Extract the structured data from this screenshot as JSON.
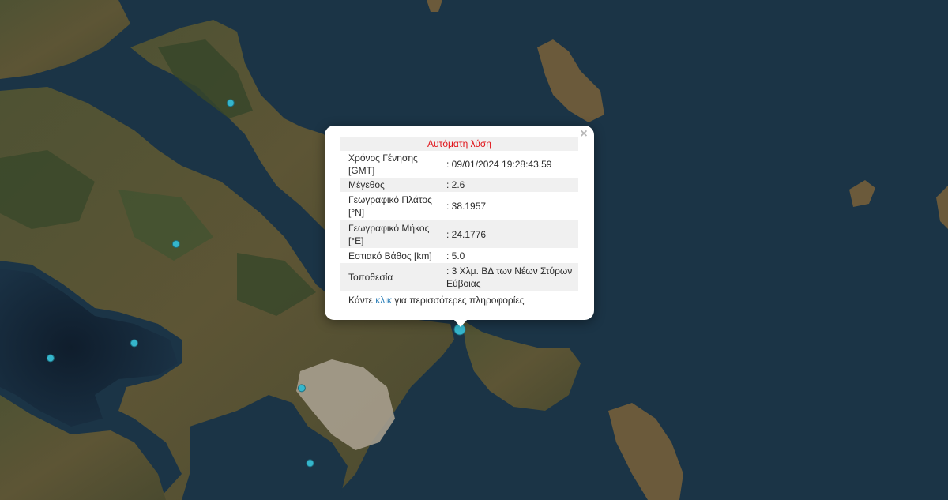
{
  "map": {
    "colors": {
      "sea": "#1b3446",
      "deep_sea": "#132333",
      "land": "#5a5436",
      "forest": "#3b4a2a",
      "urban": "#a89f8e",
      "marker_fill": "#35b6cc",
      "marker_stroke": "#1d6f80",
      "marker_green": "#2e9a63"
    },
    "markers": [
      {
        "name": "quake-marker-selected",
        "lon": 24.1776,
        "lat": 38.1957
      },
      {
        "name": "quake-marker",
        "lon": 23.8,
        "lat": 38.0
      },
      {
        "name": "quake-marker",
        "lon": 23.2,
        "lat": 38.1
      },
      {
        "name": "quake-marker",
        "lon": 22.75,
        "lat": 38.1
      },
      {
        "name": "quake-marker",
        "lon": 23.02,
        "lat": 38.35
      },
      {
        "name": "quake-marker",
        "lon": 23.4,
        "lat": 38.15
      },
      {
        "name": "quake-marker",
        "lon": 23.5,
        "lat": 38.48
      },
      {
        "name": "quake-marker",
        "lon": 23.63,
        "lat": 38.95
      },
      {
        "name": "quake-marker",
        "lon": 23.82,
        "lat": 37.75
      },
      {
        "name": "quake-marker-green",
        "lon": 22.93,
        "lat": 38.7
      }
    ]
  },
  "popup": {
    "heading": "Αυτόματη λύση",
    "rows": [
      {
        "label": "Χρόνος Γένησης [GMT]",
        "value": ": 09/01/2024 19:28:43.59"
      },
      {
        "label": "Μέγεθος",
        "value": ": 2.6"
      },
      {
        "label": "Γεωγραφικό Πλάτος [°N]",
        "value": ": 38.1957"
      },
      {
        "label": "Γεωγραφικό Μήκος [°E]",
        "value": ": 24.1776"
      },
      {
        "label": "Εστιακό Βάθος [km]",
        "value": ": 5.0"
      },
      {
        "label": "Τοποθεσία",
        "value": ": 3 Χλμ. ΒΔ των Νέων Στύρων Εύβοιας"
      }
    ],
    "more_prefix": "Κάντε",
    "more_link": "κλικ",
    "more_suffix": "για περισσότερες πληροφορίες",
    "close_symbol": "×"
  }
}
